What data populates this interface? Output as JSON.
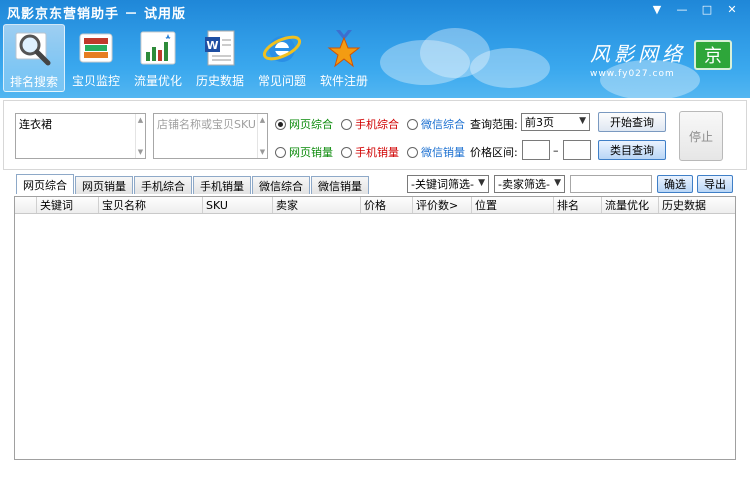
{
  "window": {
    "title": "风影京东营销助手 － 试用版",
    "controls": [
      "▼",
      "—",
      "□",
      "✕"
    ]
  },
  "toolbar": {
    "items": [
      {
        "label": "排名搜索",
        "icon": "magnifier-icon",
        "active": true
      },
      {
        "label": "宝贝监控",
        "icon": "books-icon",
        "active": false
      },
      {
        "label": "流量优化",
        "icon": "bar-chart-icon",
        "active": false
      },
      {
        "label": "历史数据",
        "icon": "word-document-icon",
        "active": false
      },
      {
        "label": "常见问题",
        "icon": "ie-browser-icon",
        "active": false
      },
      {
        "label": "软件注册",
        "icon": "medal-star-icon",
        "active": false
      }
    ]
  },
  "brand": {
    "name": "风影网络",
    "url": "www.fy027.com",
    "logo_char": "京"
  },
  "query": {
    "keyword_value": "连衣裙",
    "shop_placeholder": "店铺名称或宝贝SKU",
    "radios": [
      {
        "label": "网页综合",
        "checked": true,
        "color": "#0a8a0a"
      },
      {
        "label": "手机综合",
        "checked": false,
        "color": "#d00000"
      },
      {
        "label": "微信综合",
        "checked": false,
        "color": "#1a6fd0"
      },
      {
        "label": "网页销量",
        "checked": false,
        "color": "#0a8a0a"
      },
      {
        "label": "手机销量",
        "checked": false,
        "color": "#d00000"
      },
      {
        "label": "微信销量",
        "checked": false,
        "color": "#1a6fd0"
      }
    ],
    "range_label": "查询范围:",
    "range_value": "前3页",
    "price_label": "价格区间:",
    "price_sep": "–",
    "start_button": "开始查询",
    "category_button": "类目查询",
    "stop_button": "停止"
  },
  "tabs": [
    "网页综合",
    "网页销量",
    "手机综合",
    "手机销量",
    "微信综合",
    "微信销量"
  ],
  "filters": {
    "keyword_filter": "-关键词筛选-",
    "seller_filter": "-卖家筛选-",
    "filter_button": "确选",
    "export_button": "导出"
  },
  "grid": {
    "columns": [
      "",
      "关键词",
      "宝贝名称",
      "SKU",
      "卖家",
      "价格",
      "评价数>",
      "位置",
      "排名",
      "流量优化",
      "历史数据"
    ]
  }
}
